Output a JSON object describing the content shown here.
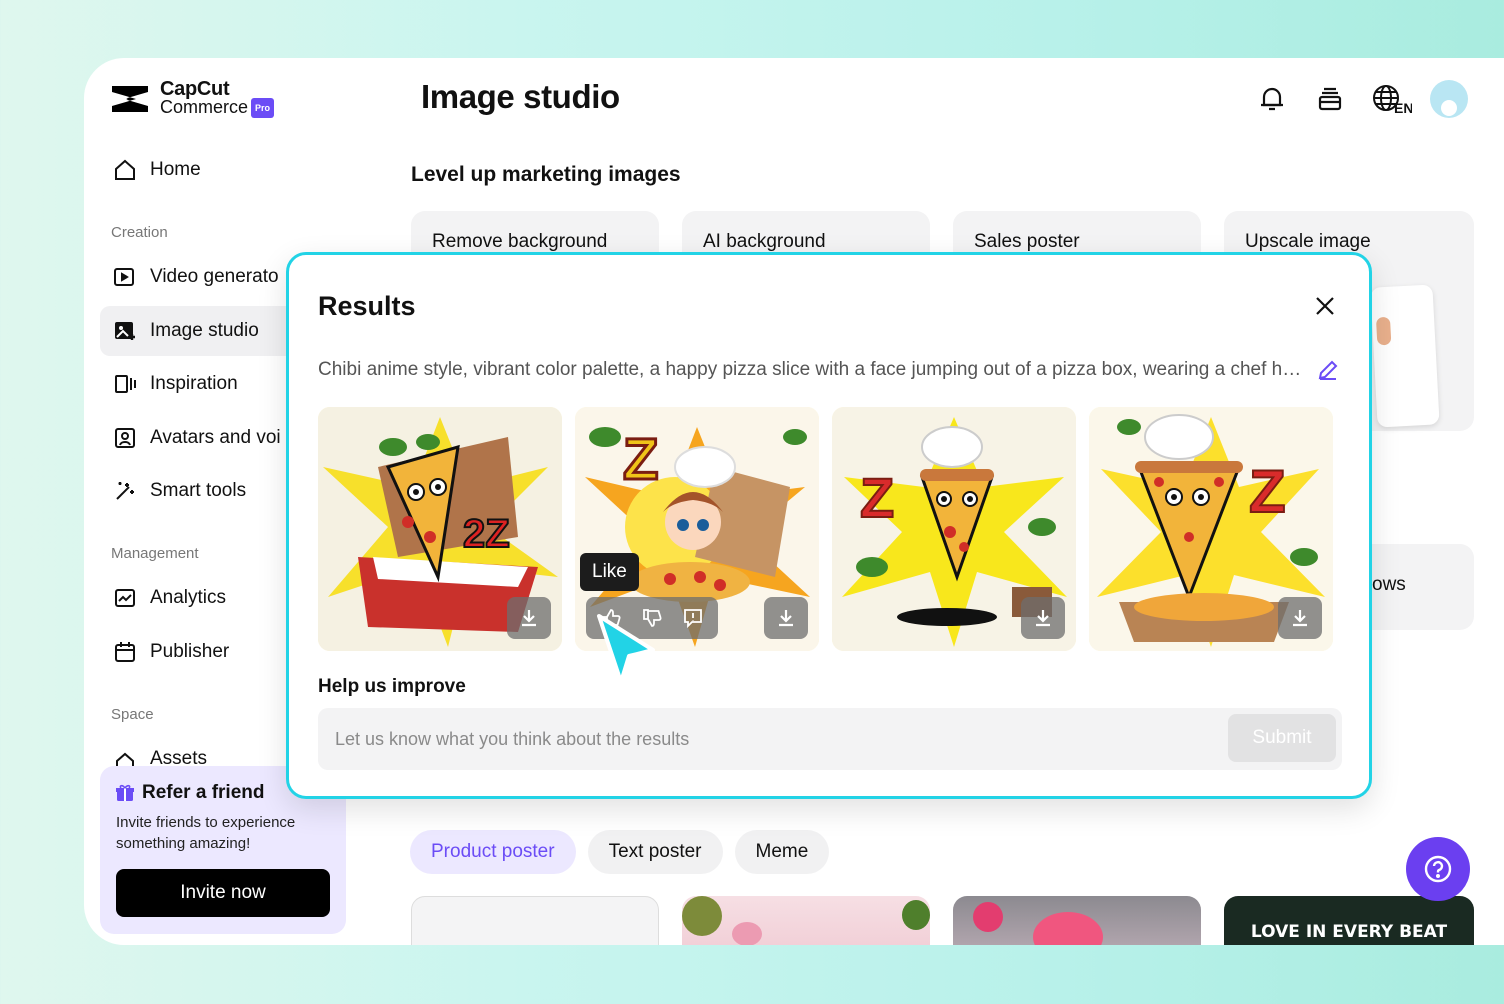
{
  "brand": {
    "name_line1": "CapCut",
    "name_line2": "Commerce",
    "badge": "Pro"
  },
  "header": {
    "title": "Image studio",
    "language": "EN"
  },
  "sidebar": {
    "home": "Home",
    "sections": {
      "creation": "Creation",
      "management": "Management",
      "space": "Space"
    },
    "items": {
      "video": "Video generato",
      "image": "Image studio",
      "inspiration": "Inspiration",
      "avatars": "Avatars and voi",
      "smart": "Smart tools",
      "analytics": "Analytics",
      "publisher": "Publisher",
      "assets": "Assets"
    },
    "refer": {
      "title": "Refer a friend",
      "desc": "Invite friends to experience something amazing!",
      "button": "Invite now"
    }
  },
  "main": {
    "subheading": "Level up marketing images",
    "tools": [
      "Remove background",
      "AI background",
      "Sales poster",
      "Upscale image"
    ],
    "side_card_label": "ows",
    "chips": [
      "Product poster",
      "Text poster",
      "Meme"
    ],
    "thumb_text": "LOVE IN EVERY BEAT"
  },
  "modal": {
    "title": "Results",
    "prompt": "Chibi anime style, vibrant color palette, a happy pizza slice with a face jumping out of a pizza box, wearing a chef hat, surrounded by basil leaves and the letter Z",
    "tooltip": "Like",
    "help_title": "Help us improve",
    "feedback_placeholder": "Let us know what you think about the results",
    "submit": "Submit"
  },
  "colors": {
    "accent": "#6b4cf6",
    "modal_border": "#22d3e6",
    "help_button": "#6b3ff0"
  },
  "icons": [
    "home-icon",
    "video-icon",
    "image-icon",
    "inspiration-icon",
    "avatar-icon",
    "wand-icon",
    "analytics-icon",
    "calendar-icon",
    "bell-icon",
    "layers-icon",
    "globe-icon",
    "close-icon",
    "pencil-icon",
    "download-icon",
    "thumbs-up-icon",
    "thumbs-down-icon",
    "report-icon",
    "help-icon",
    "gift-icon"
  ]
}
